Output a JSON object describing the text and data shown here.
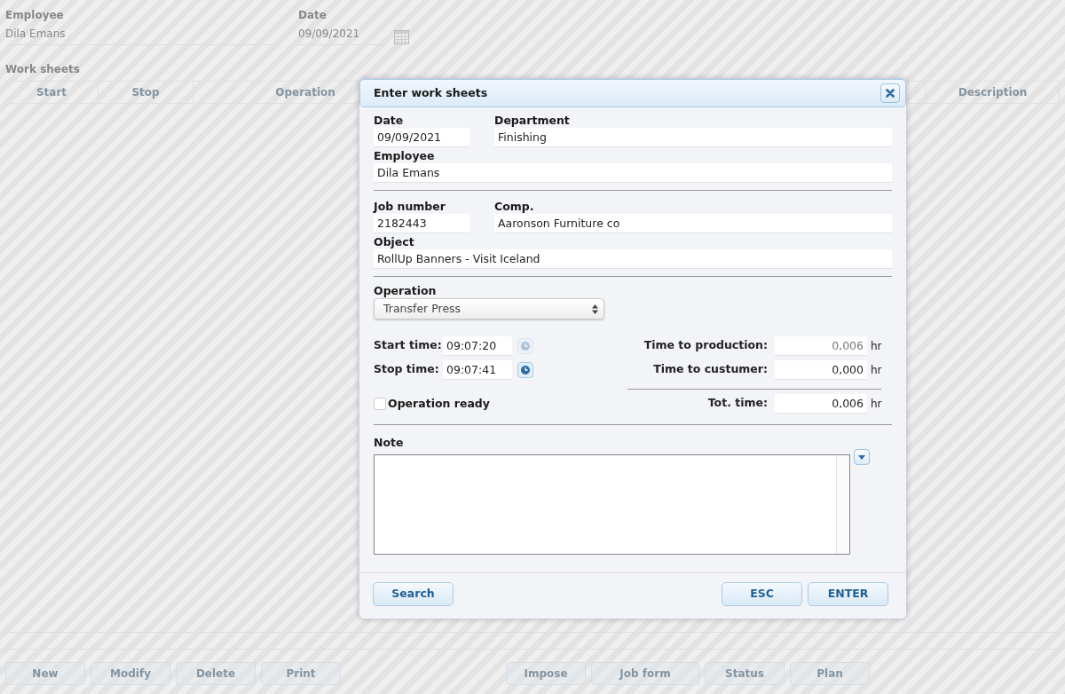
{
  "background": {
    "employee": {
      "label": "Employee",
      "value": "Dila Emans"
    },
    "date": {
      "label": "Date",
      "value": "09/09/2021"
    },
    "work_sheets": {
      "title": "Work sheets",
      "columns": [
        "Start",
        "Stop",
        "Operation",
        "Description"
      ]
    },
    "buttons": [
      "New",
      "Modify",
      "Delete",
      "Print",
      "Impose",
      "Job form",
      "Status",
      "Plan"
    ]
  },
  "dialog": {
    "title": "Enter work sheets",
    "date": {
      "label": "Date",
      "value": "09/09/2021"
    },
    "department": {
      "label": "Department",
      "value": "Finishing"
    },
    "employee": {
      "label": "Employee",
      "value": "Dila Emans"
    },
    "job_number": {
      "label": "Job number",
      "value": "2182443"
    },
    "comp": {
      "label": "Comp.",
      "value": "Aaronson Furniture co"
    },
    "object": {
      "label": "Object",
      "value": "RollUp Banners - Visit Iceland"
    },
    "operation": {
      "label": "Operation",
      "value": "Transfer Press"
    },
    "start_time": {
      "label": "Start time:",
      "value": "09:07:20",
      "clock_enabled": false
    },
    "stop_time": {
      "label": "Stop time:",
      "value": "09:07:41",
      "clock_enabled": true
    },
    "time_to_production": {
      "label": "Time to production:",
      "value": "0,006",
      "unit": "hr",
      "readonly": true
    },
    "time_to_customer": {
      "label": "Time to custumer:",
      "value": "0,000",
      "unit": "hr",
      "readonly": false
    },
    "tot_time": {
      "label": "Tot. time:",
      "value": "0,006",
      "unit": "hr",
      "readonly": false
    },
    "operation_ready": {
      "label": "Operation ready",
      "checked": false
    },
    "note": {
      "label": "Note"
    },
    "buttons": [
      "Search",
      "ESC",
      "ENTER"
    ]
  }
}
